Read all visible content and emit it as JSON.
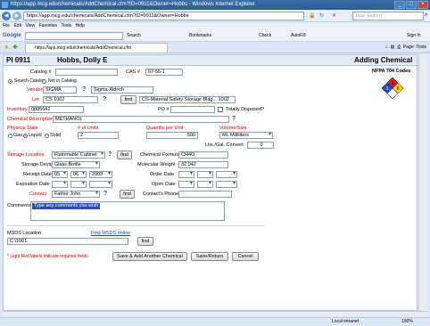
{
  "window": {
    "title": "https://app.mcg.edu/chemicals/AddChemical.cfm?ID=0911&Owner=Hobbs - Windows Internet Explorer",
    "url": "https://app.mcg.edu/chemicals/AddChemical.cfm?ID=0911&Owner=Hobbs",
    "search_placeholder": "Live Search",
    "menu": [
      "File",
      "Edit",
      "View",
      "Favorites",
      "Tools",
      "Help"
    ],
    "google_label": "Google",
    "search_btn": "Search",
    "bookmarks_btn": "Bookmarks",
    "check_btn": "Check",
    "autofill_btn": "AutoFill",
    "settings_btn": "Sign In",
    "tab_title": "https://app.mcg.edu/chemicals/AddChemical.cfm",
    "page_btn": "Page",
    "tools_btn": "Tools",
    "status_zone": "Local intranet",
    "status_zoom": "100%"
  },
  "header": {
    "pi_id": "PI 0911",
    "pi_name": "Hobbs, Dolly E",
    "page_title": "Adding Chemical"
  },
  "nfpa": {
    "label": "NFPA 704 Codes",
    "top": "3",
    "left": "1",
    "right": "0",
    "colors": {
      "top": "#e02020",
      "left": "#1e4fc8",
      "right": "#f0d020",
      "bottom": "#ffffff"
    }
  },
  "form": {
    "catalog_label": "Catalog #",
    "catalog_value": "",
    "cas_label": "CAS #",
    "cas_value": "67-56-1",
    "search_catalog_label": "Search Catalog",
    "not_in_catalog_label": "Not in Catalog",
    "vendor_label": "Vendor",
    "vendor_value": "SIGMA",
    "vendor_name": "Sigma-Aldrich",
    "lot_label": "Lot",
    "lot_value": "CS 1002",
    "lot_question": "?",
    "find_btn": "find",
    "msds_doc_value": "CS-Material Safety Storage Bldg... 1002",
    "inventory_label": "Inventory #",
    "inventory_value": "0805641",
    "po_label": "PO #",
    "po_value": "",
    "disposed_label": "Totally Disposed?",
    "chem_desc_label": "Chemical Description",
    "chem_desc_value": "METHANOL",
    "physical_state_label": "Physical State",
    "units_label": "# of Units",
    "qty_label": "Quantity per Unit",
    "volume_label": "Volume/Size",
    "state_gas": "Gas",
    "state_liquid": "Liquid",
    "state_solid": "Solid",
    "units_value": "2",
    "qty_value": "500",
    "volume_value": "ML  Milliliters",
    "lbs_conv_label": "Lbs./Gal. Convert",
    "lbs_conv_value": "0",
    "storage_loc_label": "Storage Location",
    "storage_loc_value": "Flammable Cabinet",
    "formula_label": "Chemical Formula",
    "formula_value": "CH4O",
    "storage_dev_label": "Storage Device",
    "storage_dev_value": "Glass Bottle",
    "mw_label": "Molecular Weight",
    "mw_value": "32.042",
    "receipt_label": "Receipt Date",
    "receipt_m": "05",
    "receipt_d": "06",
    "receipt_y": "2009",
    "order_label": "Order Date",
    "exp_label": "Expiration Date",
    "open_label": "Open Date",
    "contact_label": "Contact",
    "contact_value": "Father John",
    "contact_phone_label": "Contact's Phone",
    "contact_phone_value": "",
    "comments_label": "Comments",
    "comments_value": "Type any comments you wish",
    "msds_loc_label": "MSDS Location",
    "find_msds_link": "Find MSDS online",
    "msds_loc_value": "C:\\1001",
    "required_note": "* Light Red labels indicate required fields",
    "save_add_btn": "Save & Add Another Chemical",
    "save_return_btn": "Save/Return",
    "cancel_btn": "Cancel"
  }
}
